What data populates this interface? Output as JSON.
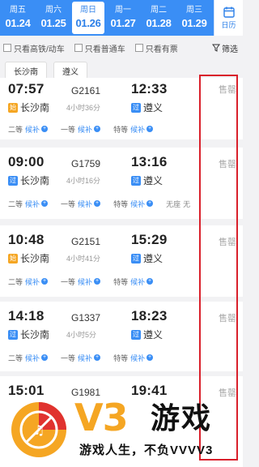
{
  "date_strip": {
    "dates": [
      {
        "weekday": "周五",
        "date": "01.24",
        "selected": false
      },
      {
        "weekday": "周六",
        "date": "01.25",
        "selected": false
      },
      {
        "weekday": "周日",
        "date": "01.26",
        "selected": true
      },
      {
        "weekday": "周一",
        "date": "01.27",
        "selected": false
      },
      {
        "weekday": "周二",
        "date": "01.28",
        "selected": false
      },
      {
        "weekday": "周三",
        "date": "01.29",
        "selected": false
      }
    ],
    "calendar_label": "日历",
    "accent_color": "#3a8ef5"
  },
  "filters": {
    "high_speed_only": "只看高铁/动车",
    "normal_only": "只看普通车",
    "available_only": "只看有票",
    "filter_label": "筛选"
  },
  "stations": {
    "from": "长沙南",
    "to": "遵义"
  },
  "trains": [
    {
      "dep_time": "07:57",
      "train_no": "G2161",
      "arr_time": "12:33",
      "from": "长沙南",
      "from_tag": "始",
      "duration": "4小时36分",
      "to": "遵义",
      "to_tag": "过",
      "status": "售罄",
      "seats": [
        {
          "label": "二等",
          "state": "候补"
        },
        {
          "label": "一等",
          "state": "候补"
        },
        {
          "label": "特等",
          "state": "候补"
        }
      ]
    },
    {
      "dep_time": "09:00",
      "train_no": "G1759",
      "arr_time": "13:16",
      "from": "长沙南",
      "from_tag": "过",
      "duration": "4小时16分",
      "to": "遵义",
      "to_tag": "过",
      "status": "售罄",
      "seats": [
        {
          "label": "二等",
          "state": "候补"
        },
        {
          "label": "一等",
          "state": "候补"
        },
        {
          "label": "特等",
          "state": "候补"
        },
        {
          "label": "无座",
          "state": "无"
        }
      ]
    },
    {
      "dep_time": "10:48",
      "train_no": "G2151",
      "arr_time": "15:29",
      "from": "长沙南",
      "from_tag": "始",
      "duration": "4小时41分",
      "to": "遵义",
      "to_tag": "过",
      "status": "售罄",
      "seats": [
        {
          "label": "二等",
          "state": "候补"
        },
        {
          "label": "一等",
          "state": "候补"
        },
        {
          "label": "特等",
          "state": "候补"
        }
      ]
    },
    {
      "dep_time": "14:18",
      "train_no": "G1337",
      "arr_time": "18:23",
      "from": "长沙南",
      "from_tag": "过",
      "duration": "4小时5分",
      "to": "遵义",
      "to_tag": "过",
      "status": "售罄",
      "seats": [
        {
          "label": "二等",
          "state": "候补"
        },
        {
          "label": "一等",
          "state": "候补"
        },
        {
          "label": "特等",
          "state": "候补"
        }
      ]
    },
    {
      "dep_time": "15:01",
      "train_no": "G1981",
      "arr_time": "19:41",
      "from": "",
      "from_tag": "",
      "duration": "",
      "to": "",
      "to_tag": "",
      "status": "售罄",
      "seats": []
    }
  ],
  "watermark": {
    "logo_text": "V3",
    "brand": "游戏",
    "slogan": "游戏人生，不负VVVV3",
    "colors": {
      "orange": "#f5a623",
      "red": "#e0322f"
    }
  },
  "annotation": {
    "color": "#d9202b"
  }
}
